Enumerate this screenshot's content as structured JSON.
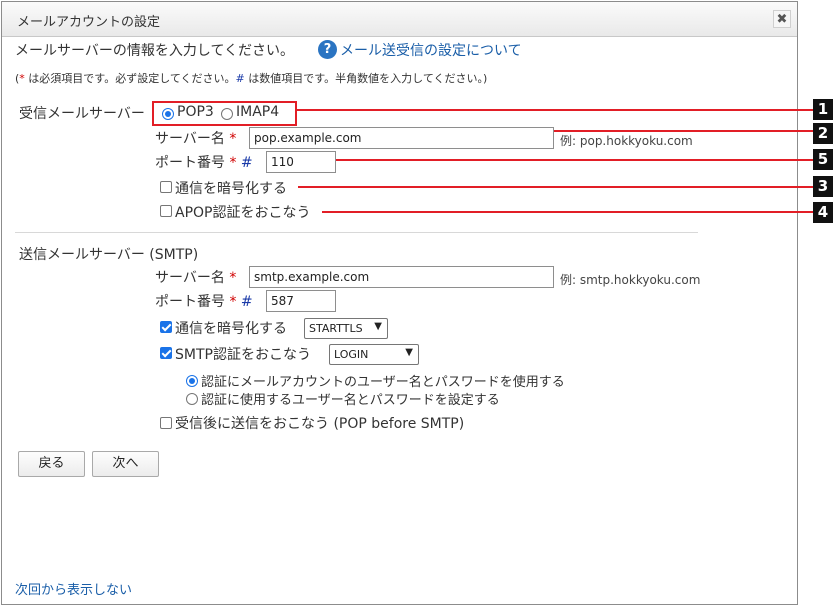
{
  "dialog": {
    "title": "メールアカウントの設定",
    "close_icon": "close-icon"
  },
  "intro": {
    "text": "メールサーバーの情報を入力してください。",
    "help_link": "メール送受信の設定について",
    "note_prefix": "(",
    "note_req_mark": "*",
    "note_mid": " は必須項目です。必ず設定してください。",
    "note_num_mark": "#",
    "note_suffix": " は数値項目です。半角数値を入力してください。)"
  },
  "receive": {
    "section_label": "受信メールサーバー",
    "protocol_pop3": "POP3",
    "protocol_imap4": "IMAP4",
    "server_label": "サーバー名",
    "server_value": "pop.example.com",
    "server_example": "例: pop.hokkyoku.com",
    "port_label": "ポート番号",
    "port_value": "110",
    "encrypt_label": "通信を暗号化する",
    "apop_label": "APOP認証をおこなう"
  },
  "send": {
    "section_label": "送信メールサーバー (SMTP)",
    "server_label": "サーバー名",
    "server_value": "smtp.example.com",
    "server_example": "例: smtp.hokkyoku.com",
    "port_label": "ポート番号",
    "port_value": "587",
    "encrypt_label": "通信を暗号化する",
    "encrypt_method": "STARTTLS",
    "auth_label": "SMTP認証をおこなう",
    "auth_method": "LOGIN",
    "auth_opt_account": "認証にメールアカウントのユーザー名とパスワードを使用する",
    "auth_opt_custom": "認証に使用するユーザー名とパスワードを設定する",
    "pop_before_smtp_label": "受信後に送信をおこなう (POP before SMTP)"
  },
  "marks": {
    "required": "*",
    "numeric": "#"
  },
  "buttons": {
    "back": "戻る",
    "next": "次へ"
  },
  "footer": {
    "dont_show": "次回から表示しない"
  },
  "callouts": [
    "1",
    "2",
    "5",
    "3",
    "4"
  ],
  "colors": {
    "callout": "#e21e26",
    "link": "#1a5ea8",
    "check_accent": "#1a73e8"
  }
}
